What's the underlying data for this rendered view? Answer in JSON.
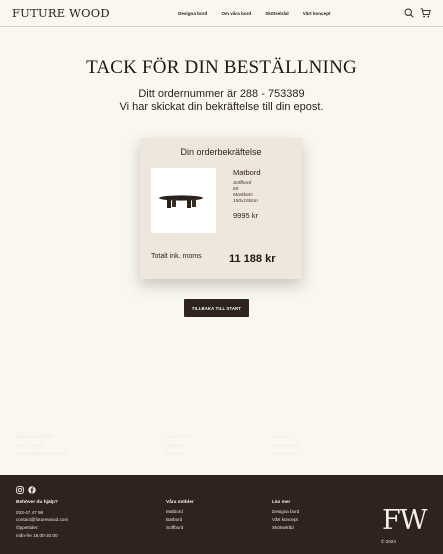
{
  "header": {
    "logo": "FUTURE WOOD",
    "nav": [
      "Designa bord",
      "Om våra bord",
      "Skötselråd",
      "Vårt koncept"
    ],
    "icons": [
      "search-icon",
      "cart-icon"
    ]
  },
  "confirmation": {
    "heading": "TACK FÖR DIN BESTÄLLNING",
    "order_line": "Ditt ordernummer är 288 - 753389",
    "email_line": "Vi har skickat din bekräftelse till din epost."
  },
  "card": {
    "title": "Din orderbekräftelse",
    "product": {
      "name": "Matbord",
      "attributes": [
        "Soffbord",
        "Ek",
        "Mörkbets",
        "150x150cm"
      ],
      "price": "9995 kr"
    },
    "total_label": "Totalt ink. moms",
    "total_value": "11 188 kr"
  },
  "back_button": "TILLBAKA TILL START",
  "footer": {
    "help": {
      "title": "Behöver du hjälp?",
      "lines": [
        "033-47 47 98",
        "contact@futurewood.com",
        "Öppettider:",
        "mån-fre 18.00-20.00"
      ]
    },
    "tables": {
      "title": "Våra möbler",
      "lines": [
        "Matbord",
        "Barbord",
        "Soffbord"
      ]
    },
    "more": {
      "title": "Läs mer",
      "lines": [
        "Designa bord",
        "Vårt koncept",
        "Skötselråd"
      ]
    },
    "logo": "FW",
    "copyright": "© 2024"
  }
}
